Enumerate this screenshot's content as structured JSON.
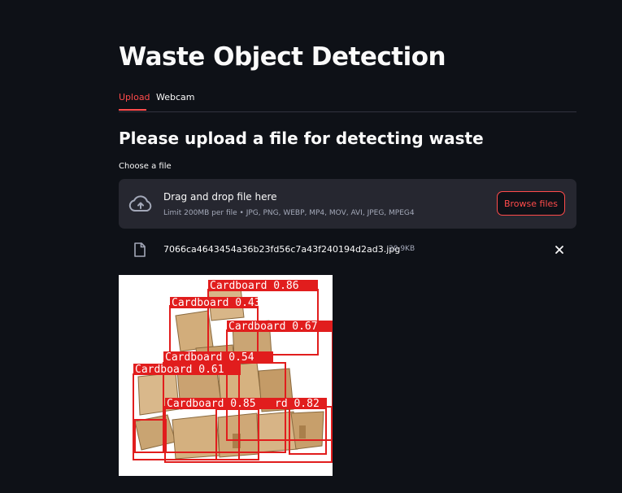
{
  "page": {
    "title": "Waste Object Detection"
  },
  "tabs": [
    {
      "label": "Upload",
      "active": true
    },
    {
      "label": "Webcam",
      "active": false
    }
  ],
  "upload": {
    "subheader": "Please upload a file for detecting waste",
    "file_label": "Choose a file",
    "dropzone_title": "Drag and drop file here",
    "dropzone_limit": "Limit 200MB per file • JPG, PNG, WEBP, MP4, MOV, AVI, JPEG, MPEG4",
    "browse_label": "Browse files"
  },
  "uploaded_file": {
    "name": "7066ca4643454a36b23fd56c7a43f240194d2ad3.jpg",
    "size": "20.9KB"
  },
  "detections": [
    {
      "label": "Cardboard 0.86"
    },
    {
      "label": "Cardboard 0.43"
    },
    {
      "label": "Cardboard 0.67"
    },
    {
      "label": "Cardboard 0.54"
    },
    {
      "label": "Cardboard 0.61"
    },
    {
      "label": "Cardboard 0.85"
    },
    {
      "label": "rd 0.82"
    }
  ],
  "colors": {
    "background": "#0e1117",
    "accent": "#ff4b4b",
    "surface": "#262730",
    "box": "#e11d1d"
  },
  "icons": {
    "upload": "cloud-upload-icon",
    "file": "file-icon",
    "remove": "close-icon"
  }
}
